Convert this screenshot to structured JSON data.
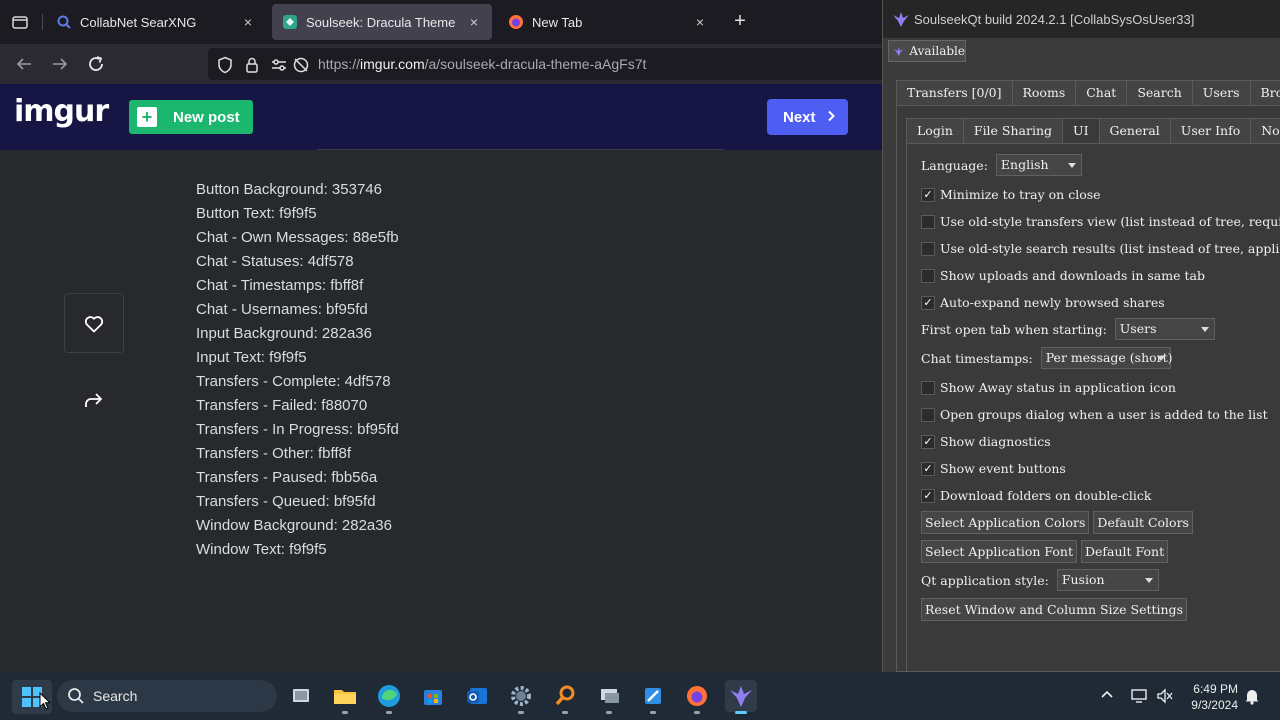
{
  "browser": {
    "tabs": [
      {
        "title": "CollabNet SearXNG",
        "close": "×"
      },
      {
        "title": "Soulseek: Dracula Theme - Imgur",
        "close": "×"
      },
      {
        "title": "New Tab",
        "close": "×"
      }
    ],
    "new_tab": "+",
    "url_prefix": "https://",
    "url_domain": "imgur.com",
    "url_path": "/a/soulseek-dracula-theme-aAgFs7t"
  },
  "imgur": {
    "logo": "imgur",
    "new_post": "New post",
    "next": "Next",
    "description_lines": [
      "Button Background: 353746",
      "Button Text: f9f9f5",
      "Chat - Own Messages: 88e5fb",
      "Chat - Statuses: 4df578",
      "Chat - Timestamps: fbff8f",
      "Chat - Usernames: bf95fd",
      "Input Background: 282a36",
      "Input Text: f9f9f5",
      "Transfers - Complete: 4df578",
      "Transfers - Failed: f88070",
      "Transfers - In Progress: bf95fd",
      "Transfers - Other: fbff8f",
      "Transfers - Paused: fbb56a",
      "Transfers - Queued: bf95fd",
      "Window Background: 282a36",
      "Window Text: f9f9f5"
    ]
  },
  "soulseek": {
    "title": "SoulseekQt build 2024.2.1 [CollabSysOsUser33]",
    "status_button": "Available",
    "main_tabs": [
      "Transfers [0/0]",
      "Rooms",
      "Chat",
      "Search",
      "Users",
      "Browse"
    ],
    "options_tabs": [
      "Login",
      "File Sharing",
      "UI",
      "General",
      "User Info",
      "Notifications"
    ],
    "language_label": "Language:",
    "language_value": "English",
    "checkboxes": {
      "minimize_tray": {
        "label": "Minimize to tray on close",
        "checked": true
      },
      "old_transfers": {
        "label": "Use old-style transfers view (list instead of tree, requires a client restart)",
        "checked": false
      },
      "old_search": {
        "label": "Use old-style search results (list instead of tree, applies to new searches)",
        "checked": false
      },
      "same_tab": {
        "label": "Show uploads and downloads in same tab",
        "checked": false
      },
      "auto_expand": {
        "label": "Auto-expand newly browsed shares",
        "checked": true
      },
      "away_icon": {
        "label": "Show Away status in application icon",
        "checked": false
      },
      "groups_dialog": {
        "label": "Open groups dialog when a user is added to the list",
        "checked": false
      },
      "diagnostics": {
        "label": "Show diagnostics",
        "checked": true
      },
      "event_buttons": {
        "label": "Show event buttons",
        "checked": true
      },
      "dl_dblclick": {
        "label": "Download folders on double-click",
        "checked": true
      }
    },
    "first_tab_label": "First open tab when starting:",
    "first_tab_value": "Users",
    "timestamps_label": "Chat timestamps:",
    "timestamps_value": "Per message (short)",
    "btn_select_colors": "Select Application Colors",
    "btn_default_colors": "Default Colors",
    "btn_select_font": "Select Application Font",
    "btn_default_font": "Default Font",
    "style_label": "Qt application style:",
    "style_value": "Fusion",
    "btn_reset": "Reset Window and Column Size Settings",
    "check_mark": "✓"
  },
  "taskbar": {
    "search_label": "Search",
    "time": "6:49 PM",
    "date": "9/3/2024"
  },
  "colors": {
    "imgur_header": "#171544",
    "new_post_green": "#1bb76e",
    "next_blue": "#4e5df2",
    "taskbar_accent": "#60cdff"
  }
}
